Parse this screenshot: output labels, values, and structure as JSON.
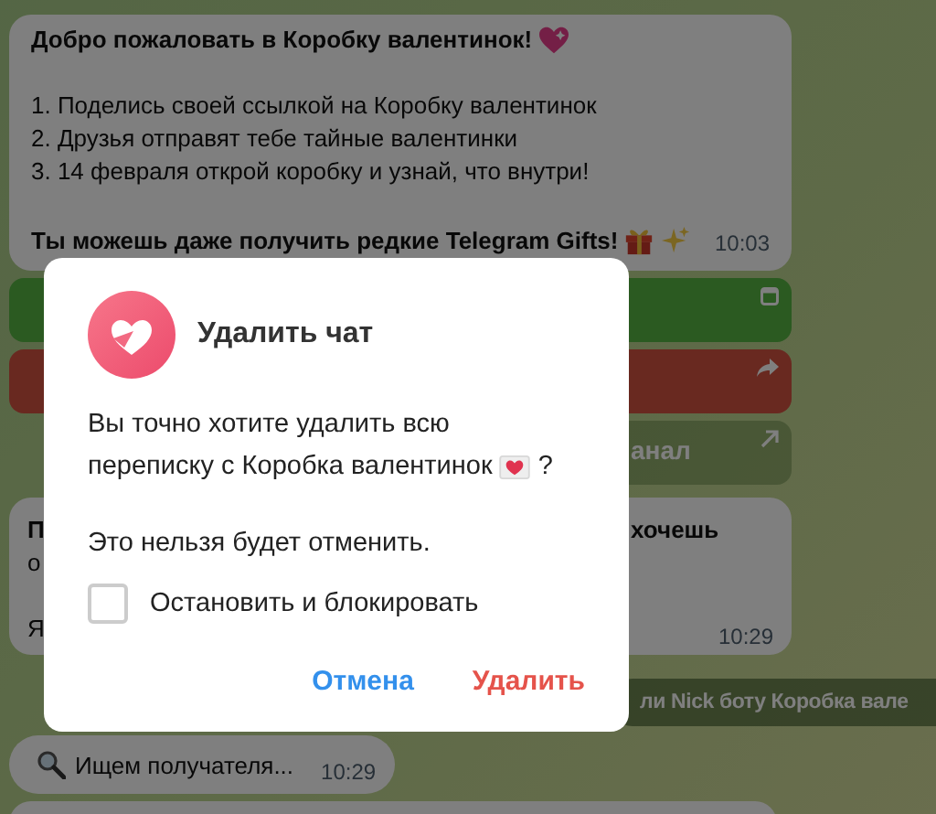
{
  "chat": {
    "welcome": {
      "title": "Добро пожаловать в Коробку валентинок!",
      "steps": [
        "1. Поделись своей ссылкой на Коробку валентинок",
        "2. Друзья отправят тебе тайные валентинки",
        "3. 14 февраля открой коробку и узнай, что внутри!"
      ],
      "footer": "Ты можешь даже получить редкие Telegram Gifts!",
      "time": "10:03"
    },
    "buttons": [
      {
        "kind": "app"
      },
      {
        "kind": "share"
      },
      {
        "kind": "link",
        "label": "анал"
      }
    ],
    "message": {
      "lines": [
        {
          "left": "П",
          "right": "хочешь",
          "gap_before": false
        },
        {
          "left": "о",
          "gap_before": false
        },
        {
          "left": "Я",
          "gap_before": true
        }
      ],
      "time": "10:29"
    },
    "service": "ли Nick боту Коробка вале",
    "search": {
      "text": "Ищем получателя...",
      "time": "10:29"
    }
  },
  "dialog": {
    "title": "Удалить чат",
    "question": [
      "Вы точно хотите удалить всю",
      "переписку с Коробка валентинок"
    ],
    "question_end": "?",
    "warning": "Это нельзя будет отменить.",
    "checkbox": {
      "label": "Остановить и блокировать",
      "checked": false
    },
    "actions": [
      {
        "label": "Отмена",
        "kind": "cancel"
      },
      {
        "label": "Удалить",
        "kind": "danger"
      }
    ]
  }
}
